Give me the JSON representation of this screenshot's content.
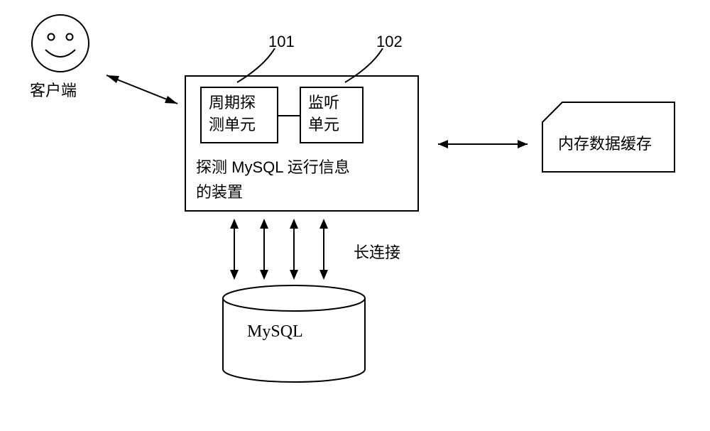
{
  "callouts": {
    "label_101": "101",
    "label_102": "102"
  },
  "client": {
    "label": "客户端"
  },
  "main_device": {
    "probe_unit": "周期探\n测单元",
    "listen_unit": "监听\n单元",
    "caption": "探测 MySQL 运行信息\n的装置"
  },
  "cache": {
    "label": "内存数据缓存"
  },
  "connection": {
    "label": "长连接"
  },
  "database": {
    "label": "MySQL"
  }
}
